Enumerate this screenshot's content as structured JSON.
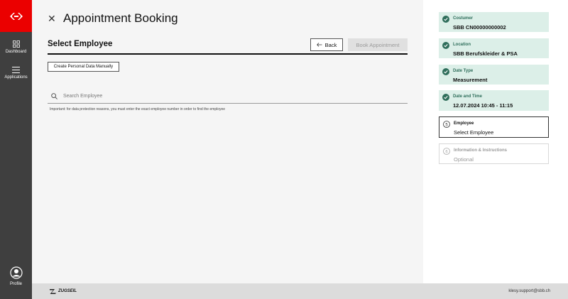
{
  "rail": {
    "items": [
      {
        "label": "Dashboard",
        "icon": "dashboard-icon"
      },
      {
        "label": "Applications",
        "icon": "menu-icon"
      }
    ],
    "profile_label": "Profile",
    "brand_color": "#eb0000"
  },
  "header": {
    "title": "Appointment Booking",
    "close_icon": "close-icon"
  },
  "main": {
    "section_title": "Select Employee",
    "back_label": "Back",
    "book_label": "Book Appointment",
    "manual_button_label": "Create Personal Data Manually",
    "search_placeholder": "Search Employee",
    "note": "Important: for data protection reasons, you must enter the exact employee number in order to find the employee"
  },
  "steps": [
    {
      "title": "Costumer",
      "value": "SBB  CN00000000002",
      "status": "done"
    },
    {
      "title": "Location",
      "value": "SBB Berufskleider & PSA",
      "status": "done"
    },
    {
      "title": "Date Type",
      "value": "Measurement",
      "status": "done"
    },
    {
      "title": "Date and Time",
      "value": "12.07.2024  10:45 - 11:15",
      "status": "done"
    },
    {
      "title": "Employee",
      "value": "Select Employee",
      "status": "active"
    },
    {
      "title": "Information & Instructions",
      "value": "Optional",
      "status": "pending"
    }
  ],
  "footer": {
    "brand": "ZUGSEIL",
    "support_email": "klesy.support@sbb.ch"
  },
  "colors": {
    "done_bg": "#dcefe8",
    "done_accent": "#2f6e5b",
    "rail_bg": "#3f3f3f"
  }
}
